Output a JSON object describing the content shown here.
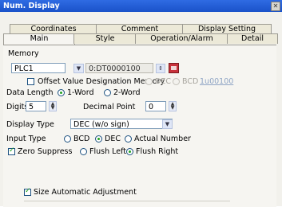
{
  "window": {
    "title": "Num. Display",
    "close_glyph": "✕"
  },
  "tabs_top": [
    "Coordinates",
    "Comment",
    "Display Setting"
  ],
  "tabs_bottom": [
    "Main",
    "Style",
    "Operation/Alarm",
    "Detail"
  ],
  "memory": {
    "label": "Memory",
    "plc": "PLC1",
    "address": "0:DT0000100",
    "offset_label": "Offset Value Designation Memory",
    "offset_dec": "DEC",
    "offset_bcd": "BCD",
    "offset_link": "1u00100"
  },
  "data_length": {
    "label": "Data Length",
    "opt1": "1-Word",
    "opt2": "2-Word"
  },
  "digits": {
    "label": "Digits",
    "value": "5"
  },
  "decimal_point": {
    "label": "Decimal Point",
    "value": "0"
  },
  "display_type": {
    "label": "Display Type",
    "value": "DEC (w/o sign)"
  },
  "input_type": {
    "label": "Input Type",
    "opt_bcd": "BCD",
    "opt_dec": "DEC",
    "opt_actual": "Actual Number"
  },
  "zero_suppress": {
    "label": "Zero Suppress",
    "opt_left": "Flush Left",
    "opt_right": "Flush Right"
  },
  "size_auto": {
    "label": "Size Automatic Adjustment"
  }
}
